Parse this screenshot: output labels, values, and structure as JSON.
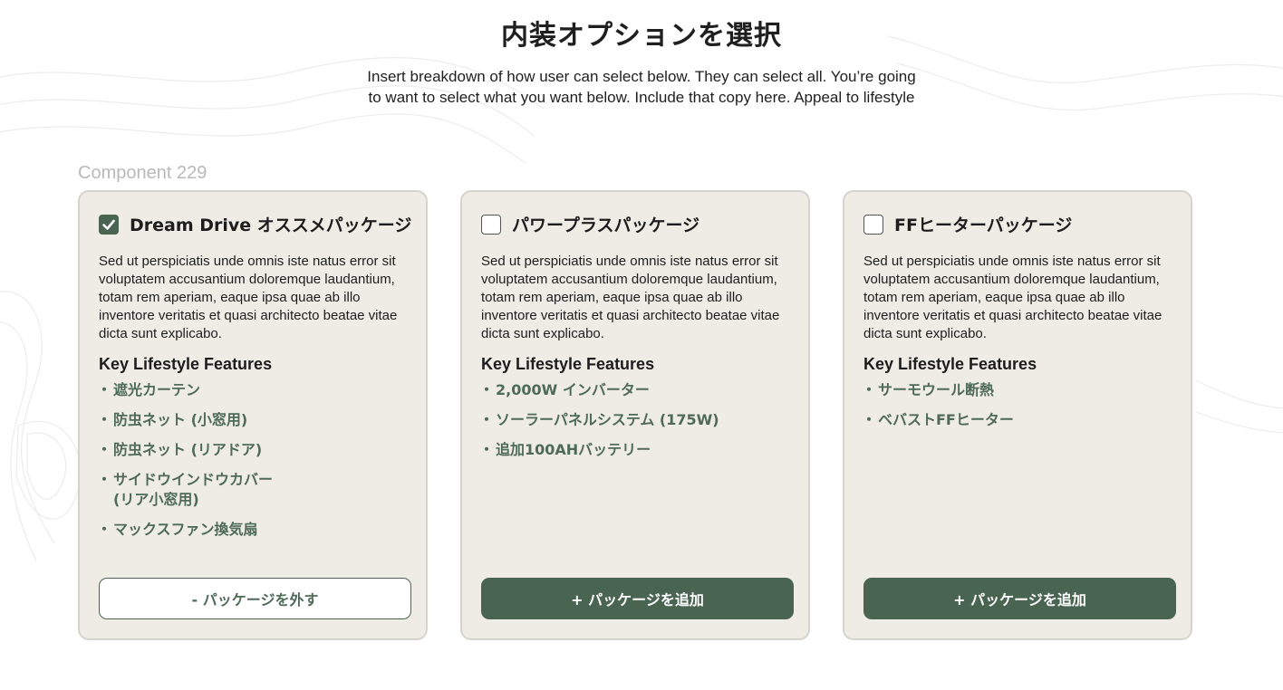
{
  "page": {
    "title": "内装オプションを選択",
    "subtitle": "Insert breakdown of how user can select below. They can select all. You’re going to want to select what you want below. Include that copy here. Appeal to lifestyle",
    "component_label": "Component 229"
  },
  "colors": {
    "accent": "#496552",
    "feature_text": "#4f6b58",
    "card_bg": "#efece6",
    "card_border": "#d6d3cd"
  },
  "cards": [
    {
      "checked": true,
      "checkbox_icon": "checkmark-icon",
      "title": "Dream Drive オススメパッケージ",
      "description": "Sed ut perspiciatis unde omnis iste natus error sit voluptatem accusantium doloremque laudantium, totam rem aperiam, eaque ipsa quae ab illo inventore veritatis et quasi architecto beatae vitae dicta sunt explicabo.",
      "features_heading": "Key Lifestyle Features",
      "features": [
        "遮光カーテン",
        "防虫ネット (小窓用)",
        "防虫ネット (リアドア)",
        "サイドウインドウカバー\n(リア小窓用)",
        "マックスファン換気扇"
      ],
      "button_label": "- パッケージを外す"
    },
    {
      "checked": false,
      "title": "パワープラスパッケージ",
      "description": "Sed ut perspiciatis unde omnis iste natus error sit voluptatem accusantium doloremque laudantium, totam rem aperiam, eaque ipsa quae ab illo inventore veritatis et quasi architecto beatae vitae dicta sunt explicabo.",
      "features_heading": "Key Lifestyle Features",
      "features": [
        "2,000W インバーター",
        "ソーラーパネルシステム (175W)",
        "追加100AHバッテリー"
      ],
      "button_label": "+ パッケージを追加"
    },
    {
      "checked": false,
      "title": "FFヒーターパッケージ",
      "description": "Sed ut perspiciatis unde omnis iste natus error sit voluptatem accusantium doloremque laudantium, totam rem aperiam, eaque ipsa quae ab illo inventore veritatis et quasi architecto beatae vitae dicta sunt explicabo.",
      "features_heading": "Key Lifestyle Features",
      "features": [
        "サーモウール断熱",
        "ベバストFFヒーター"
      ],
      "button_label": "+ パッケージを追加"
    }
  ]
}
